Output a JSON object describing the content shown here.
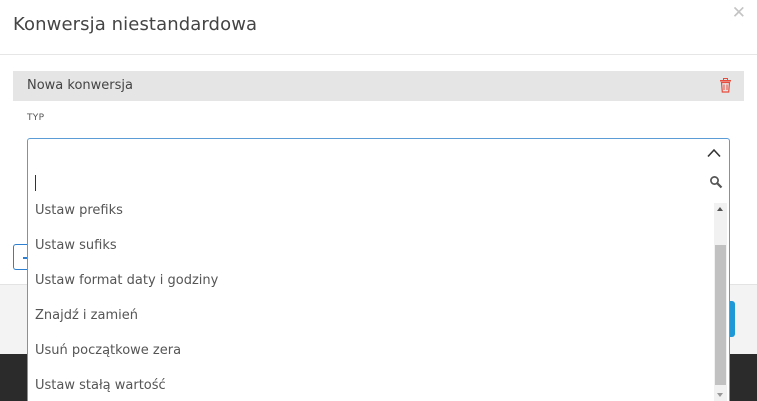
{
  "modal": {
    "title": "Konwersja niestandardowa",
    "close_icon": "close-icon"
  },
  "conversion": {
    "name": "Nowa konwersja",
    "delete_icon": "trash-icon",
    "delete_color": "#e74c3c"
  },
  "type_field": {
    "label": "TYP",
    "search_value": "",
    "options": [
      "Ustaw prefiks",
      "Ustaw sufiks",
      "Ustaw format daty i godziny",
      "Znajdź i zamień",
      "Usuń początkowe zera",
      "Ustaw stałą wartość"
    ]
  },
  "colors": {
    "accent": "#1f98d8",
    "border_focus": "#5b9bd6"
  }
}
